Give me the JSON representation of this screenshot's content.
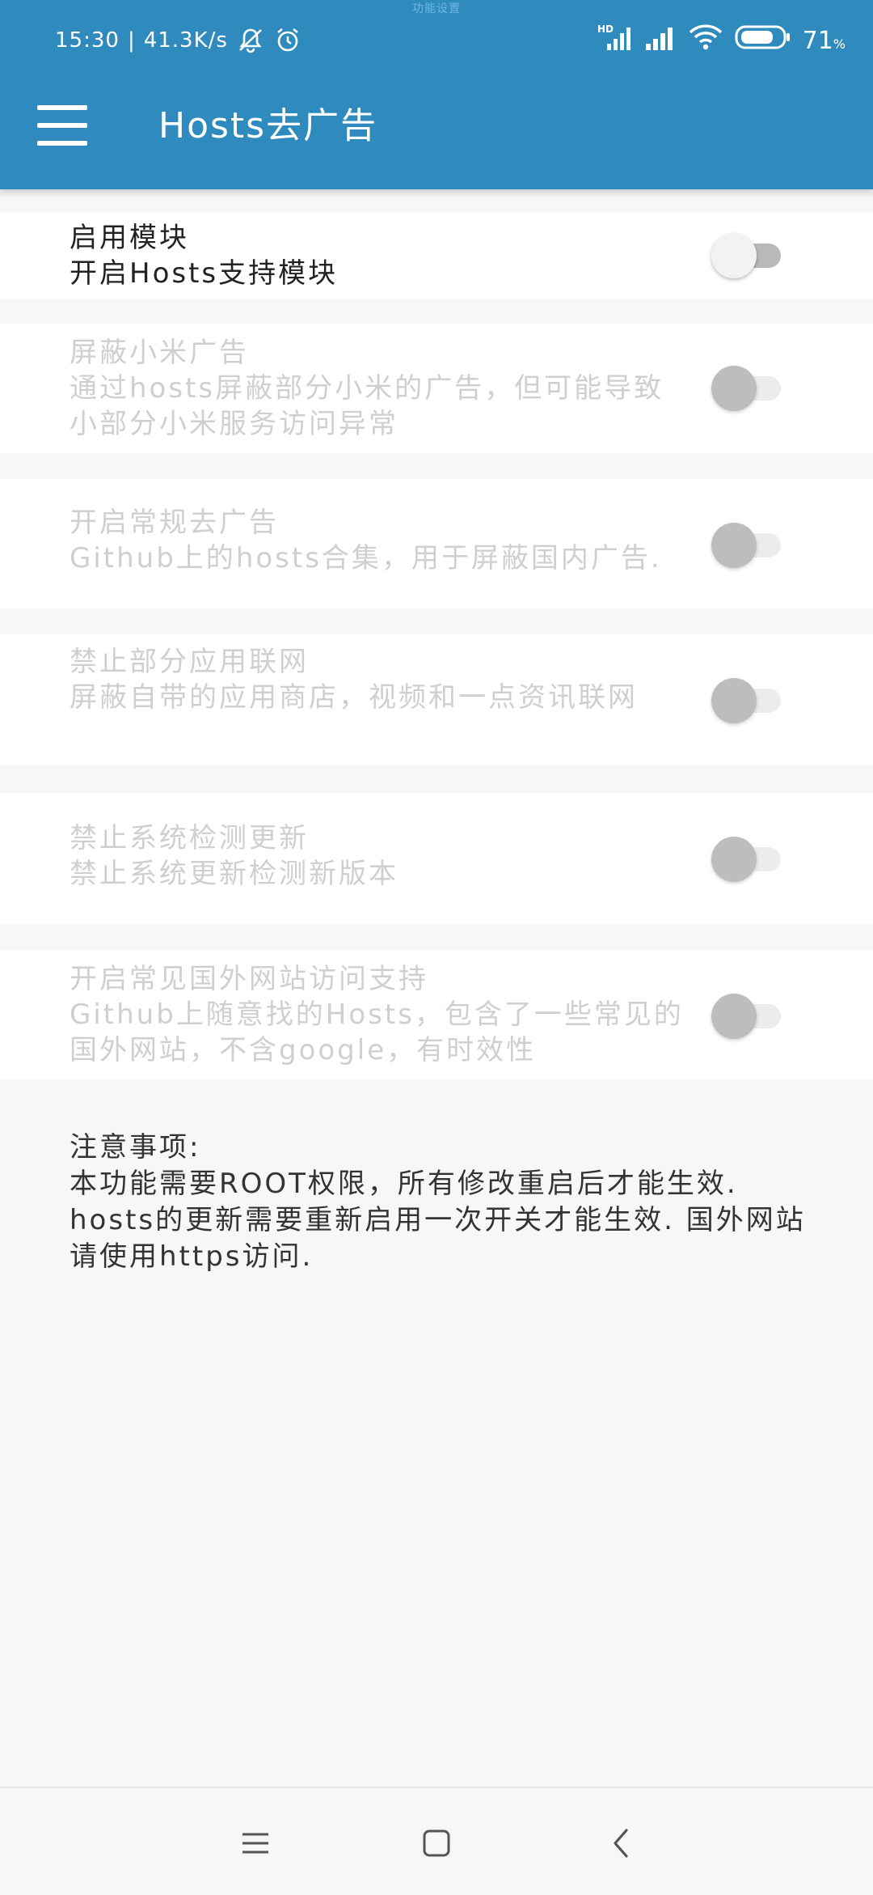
{
  "status_bar": {
    "notification_text": "功能设置",
    "time": "15:30",
    "net_speed": "41.3K/s",
    "network_type": "HD",
    "battery_level": "71",
    "battery_unit": "%",
    "icons": [
      "bell-off-icon",
      "alarm-icon",
      "signal-hd-icon",
      "signal-icon",
      "wifi-icon",
      "battery-icon"
    ]
  },
  "app_bar": {
    "title": "Hosts去广告",
    "menu_icon": "hamburger-menu-icon",
    "color": "#2f8bbd"
  },
  "settings": [
    {
      "title": "启用模块",
      "subtitle": "开启Hosts支持模块",
      "checked": false,
      "enabled": true
    },
    {
      "title": "屏蔽小米广告",
      "subtitle": "通过hosts屏蔽部分小米的广告，但可能导致小部分小米服务访问异常",
      "checked": false,
      "enabled": false
    },
    {
      "title": "开启常规去广告",
      "subtitle": "Github上的hosts合集，用于屏蔽国内广告.",
      "checked": false,
      "enabled": false
    },
    {
      "title": "禁止部分应用联网",
      "subtitle": "屏蔽自带的应用商店，视频和一点资讯联网",
      "checked": false,
      "enabled": false
    },
    {
      "title": "禁止系统检测更新",
      "subtitle": "禁止系统更新检测新版本",
      "checked": false,
      "enabled": false
    },
    {
      "title": "开启常见国外网站访问支持",
      "subtitle": "Github上随意找的Hosts，包含了一些常见的国外网站，不含google，有时效性",
      "checked": false,
      "enabled": false
    }
  ],
  "notes": {
    "title": "注意事项:",
    "body": "本功能需要ROOT权限，所有修改重启后才能生效. hosts的更新需要重新启用一次开关才能生效. 国外网站请使用https访问."
  },
  "nav_bar": {
    "icons": [
      "recents-icon",
      "home-icon",
      "back-icon"
    ]
  }
}
